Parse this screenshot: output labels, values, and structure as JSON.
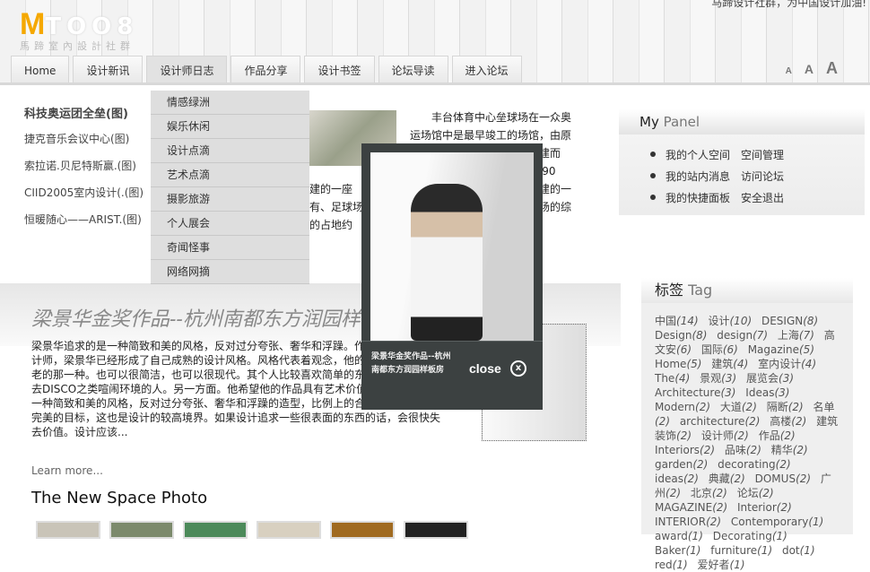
{
  "header": {
    "tagline": "马蹄设计社群，为中国设计加油!",
    "logo_m": "M",
    "logo_rest": "TOO8",
    "logo_sub": "馬蹄室內設計社群"
  },
  "nav": [
    "Home",
    "设计新讯",
    "设计师日志",
    "作品分享",
    "设计书签",
    "论坛导读",
    "进入论坛"
  ],
  "font_sizes": [
    "A",
    "A",
    "A"
  ],
  "dropdown": [
    "情感绿洲",
    "娱乐休闲",
    "设计点滴",
    "艺术点滴",
    "摄影旅游",
    "个人展会",
    "奇闻怪事",
    "网络网摘"
  ],
  "left_list": [
    "科技奥运团全垒(图)",
    "捷克音乐会议中心(图)",
    "索拉诺.贝尼特斯赢.(图)",
    "CIID2005室内设计(.(图)",
    "恒暖随心——ARIST.(图)"
  ],
  "story": "丰台体育中心垒球场在一众奥运场馆中是最早竣工的场馆，由原来的丰台体育中心棒球场改建而成。丰台体育中心始建于1990年，是为第十一届亚运会新建的一座有游泳馆、田径场、足球场的综合性体育中心，位于北京西南，占地约20公顷。",
  "story2": "建的一座有、足球场的占地约20公",
  "article": {
    "title": "梁景华金奖作品--杭州南都东方润园样板房",
    "body": "梁景华追求的是一种简致和美的风格，反对过分夸张、奢华和浮躁。作为一个成熟的设计师，梁景华已经形成了自己成熟的设计风格。风格代表着观念，他的优雅并非豪华古老的那一种。也可以很简洁，也可以很现代。其个人比较喜欢简单的东西。不是那种常去DISCO之类喧闹环境的人。另一方面。他希望他的作品具有艺术价值。因此追求的是一种简致和美的风格，反对过分夸张、奢华和浮躁的造型，比例上的合理是其追求达到完美的目标，这也是设计的较高境界。如果设计追求一些很表面的东西的话，会很快失去价值。设计应该...",
    "learn_more": "Learn more..."
  },
  "new_space": {
    "title": "The New Space Photo"
  },
  "popup": {
    "caption": "梁景华金奖作品--杭州南都东方润园样板房",
    "close": "close",
    "close_icon": "x"
  },
  "my_panel": {
    "title_a": "My",
    "title_b": " Panel",
    "rows": [
      [
        "我的个人空间",
        "空间管理"
      ],
      [
        "我的站内消息",
        "访问论坛"
      ],
      [
        "我的快捷面板",
        "安全退出"
      ]
    ]
  },
  "tags": {
    "title_a": "标签",
    "title_b": " Tag",
    "items": [
      [
        "中国",
        "(14)"
      ],
      [
        "设计",
        "(10)"
      ],
      [
        "DESIGN",
        "(8)"
      ],
      [
        "Design",
        "(8)"
      ],
      [
        "design",
        "(7)"
      ],
      [
        "上海",
        "(7)"
      ],
      [
        "高文安",
        "(6)"
      ],
      [
        "国际",
        "(6)"
      ],
      [
        "Magazine",
        "(5)"
      ],
      [
        "Home",
        "(5)"
      ],
      [
        "建筑",
        "(4)"
      ],
      [
        "室内设计",
        "(4)"
      ],
      [
        "The",
        "(4)"
      ],
      [
        "景观",
        "(3)"
      ],
      [
        "展览会",
        "(3)"
      ],
      [
        "Architecture",
        "(3)"
      ],
      [
        "Ideas",
        "(3)"
      ],
      [
        "Modern",
        "(2)"
      ],
      [
        "大道",
        "(2)"
      ],
      [
        "隔断",
        "(2)"
      ],
      [
        "名单",
        "(2)"
      ],
      [
        "architecture",
        "(2)"
      ],
      [
        "高楼",
        "(2)"
      ],
      [
        "建筑装饰",
        "(2)"
      ],
      [
        "设计师",
        "(2)"
      ],
      [
        "作品",
        "(2)"
      ],
      [
        "Interiors",
        "(2)"
      ],
      [
        "品味",
        "(2)"
      ],
      [
        "精华",
        "(2)"
      ],
      [
        "garden",
        "(2)"
      ],
      [
        "decorating",
        "(2)"
      ],
      [
        "ideas",
        "(2)"
      ],
      [
        "典藏",
        "(2)"
      ],
      [
        "DOMUS",
        "(2)"
      ],
      [
        "广州",
        "(2)"
      ],
      [
        "北京",
        "(2)"
      ],
      [
        "论坛",
        "(2)"
      ],
      [
        "MAGAZINE",
        "(2)"
      ],
      [
        "Interior",
        "(2)"
      ],
      [
        "INTERIOR",
        "(2)"
      ],
      [
        "Contemporary",
        "(1)"
      ],
      [
        "award",
        "(1)"
      ],
      [
        "Decorating",
        "(1)"
      ],
      [
        "Baker",
        "(1)"
      ],
      [
        "furniture",
        "(1)"
      ],
      [
        "dot",
        "(1)"
      ],
      [
        "red",
        "(1)"
      ],
      [
        "爱好者",
        "(1)"
      ]
    ]
  }
}
